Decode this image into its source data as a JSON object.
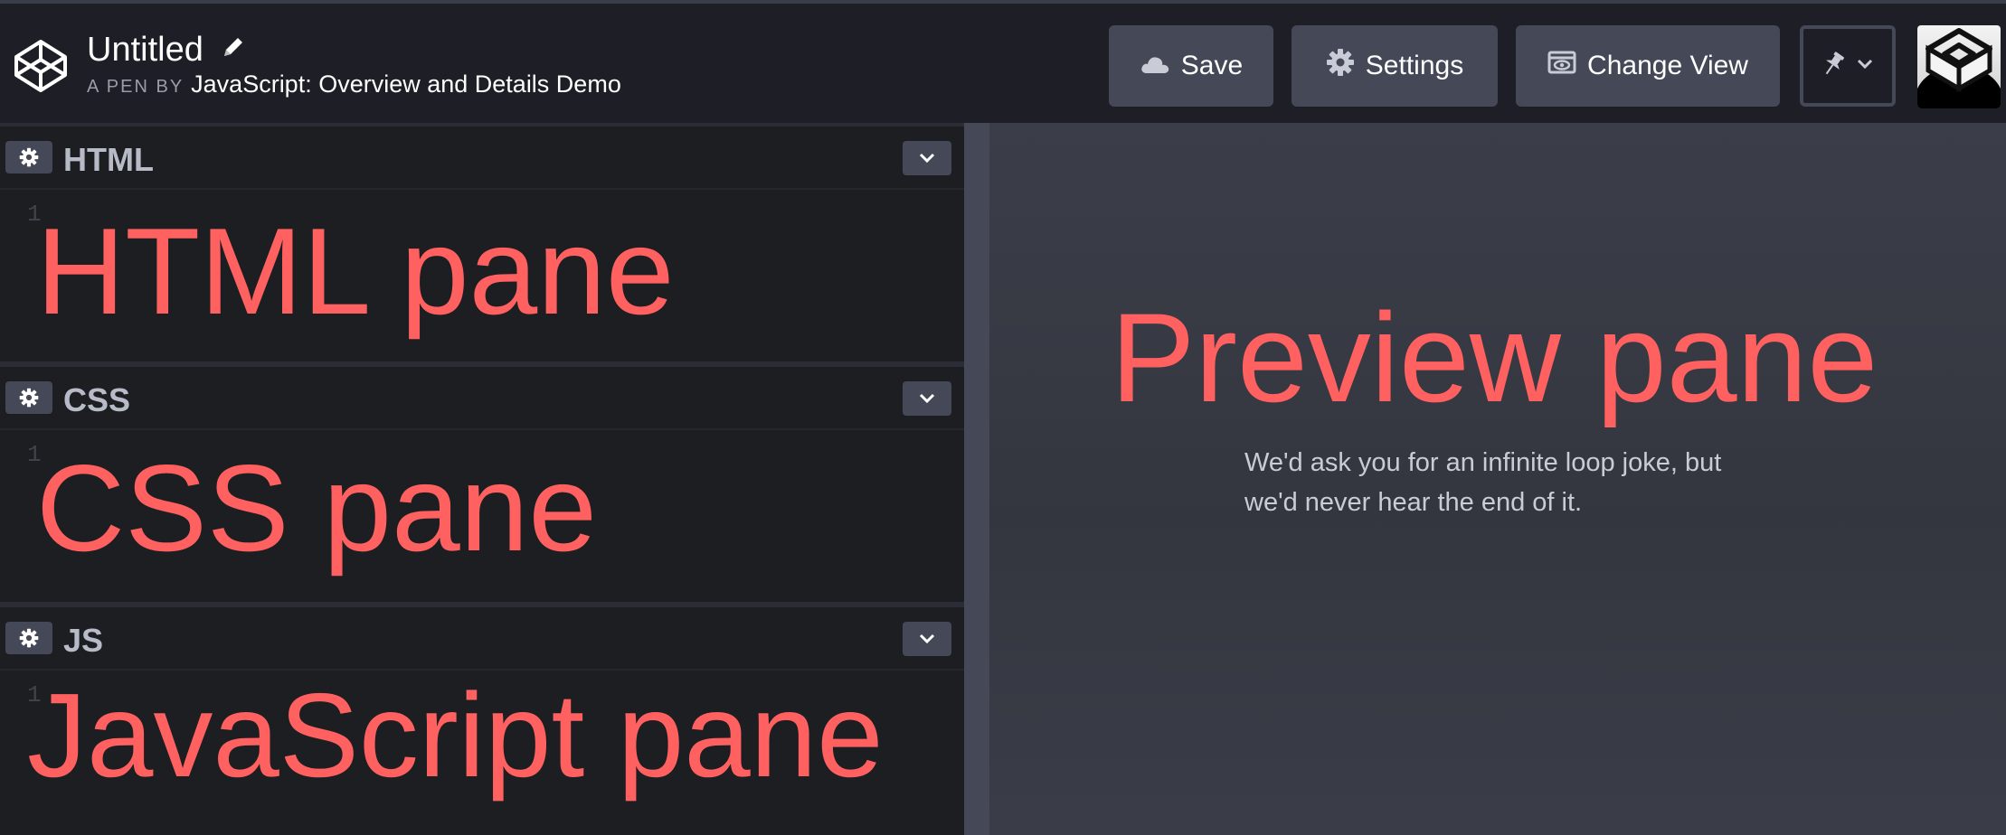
{
  "header": {
    "title": "Untitled",
    "byline_prefix": "A PEN BY",
    "author": "JavaScript: Overview and Details Demo",
    "buttons": {
      "save": "Save",
      "settings": "Settings",
      "change_view": "Change View"
    }
  },
  "panes": {
    "html": {
      "name": "HTML",
      "line_number": "1",
      "annotation": "HTML pane"
    },
    "css": {
      "name": "CSS",
      "line_number": "1",
      "annotation": "CSS pane"
    },
    "js": {
      "name": "JS",
      "line_number": "1",
      "annotation": "JavaScript pane"
    }
  },
  "preview": {
    "annotation": "Preview pane",
    "text": "We'd ask you for an infinite loop joke, but we'd never hear the end of it."
  },
  "colors": {
    "annotation": "#ff6161",
    "header_bg": "#1e1f26",
    "button_bg": "#444857",
    "editor_bg": "#1d1e22",
    "preview_bg": "#3b3d49"
  }
}
